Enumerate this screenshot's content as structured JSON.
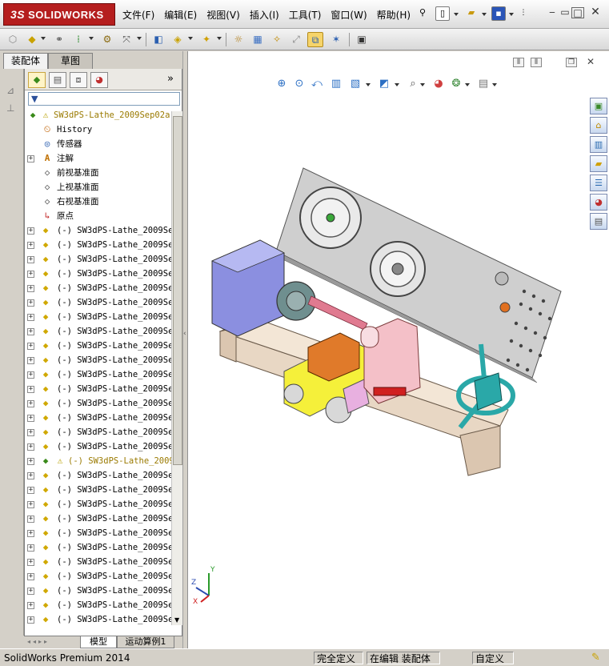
{
  "app": {
    "brand": "SOLIDWORKS",
    "brand_prefix": "3S",
    "menus": [
      "文件(F)",
      "编辑(E)",
      "视图(V)",
      "插入(I)",
      "工具(T)",
      "窗口(W)",
      "帮助(H)"
    ]
  },
  "panel_tabs": [
    "装配体",
    "草图"
  ],
  "tree": {
    "root": "SW3dPS-Lathe_2009Sep02a",
    "fixed_items": [
      {
        "label": "History",
        "icon": "history-icon"
      },
      {
        "label": "传感器",
        "icon": "sensor-icon"
      },
      {
        "label": "注解",
        "icon": "annotation-icon"
      },
      {
        "label": "前视基准面",
        "icon": "plane-icon"
      },
      {
        "label": "上视基准面",
        "icon": "plane-icon"
      },
      {
        "label": "右视基准面",
        "icon": "plane-icon"
      },
      {
        "label": "原点",
        "icon": "origin-icon"
      }
    ],
    "components": [
      "(-) SW3dPS-Lathe_2009Se",
      "(-) SW3dPS-Lathe_2009Se",
      "(-) SW3dPS-Lathe_2009Se",
      "(-) SW3dPS-Lathe_2009Se",
      "(-) SW3dPS-Lathe_2009Se",
      "(-) SW3dPS-Lathe_2009Se",
      "(-) SW3dPS-Lathe_2009Se",
      "(-) SW3dPS-Lathe_2009Se",
      "(-) SW3dPS-Lathe_2009Se",
      "(-) SW3dPS-Lathe_2009Se",
      "(-) SW3dPS-Lathe_2009Se",
      "(-) SW3dPS-Lathe_2009Se",
      "(-) SW3dPS-Lathe_2009Se",
      "(-) SW3dPS-Lathe_2009Se",
      "(-) SW3dPS-Lathe_2009Se",
      "(-) SW3dPS-Lathe_2009Se",
      "(-) SW3dPS-Lathe_2009",
      "(-) SW3dPS-Lathe_2009Se",
      "(-) SW3dPS-Lathe_2009Se",
      "(-) SW3dPS-Lathe_2009Se",
      "(-) SW3dPS-Lathe_2009Se",
      "(-) SW3dPS-Lathe_2009Se",
      "(-) SW3dPS-Lathe_2009Se",
      "(-) SW3dPS-Lathe_2009Se",
      "(-) SW3dPS-Lathe_2009Se",
      "(-) SW3dPS-Lathe_2009Se",
      "(-) SW3dPS-Lathe_2009Se",
      "(-) SW3dPS-Lathe_2009Se"
    ],
    "warning_component_index": 16
  },
  "bottom_tabs": [
    "模型",
    "运动算例1"
  ],
  "status": {
    "product": "SolidWorks Premium 2014",
    "definition": "完全定义",
    "editing": "在编辑 装配体",
    "units": "自定义"
  },
  "triad_labels": {
    "x": "X",
    "y": "Y",
    "z": "Z"
  },
  "colors": {
    "brand_red": "#b51e1e",
    "viewport_bg": "#ffffff",
    "active_tool": "#f6d46a",
    "lathe_bed": "#e8d7c4",
    "headstock": "#8b8fe0",
    "carriage": "#f5f03a",
    "tailstock": "#f4c0c8",
    "handwheel": "#2aa8a8",
    "panel_gray": "#cfcfcf"
  }
}
